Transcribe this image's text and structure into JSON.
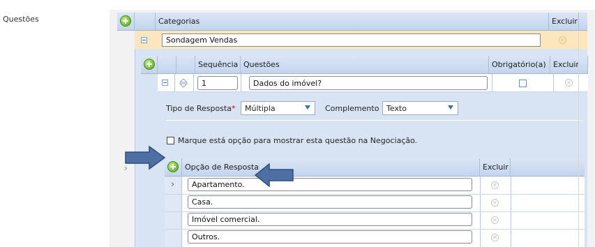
{
  "page": {
    "label": "Questões"
  },
  "categories_grid": {
    "header": {
      "col_categorias": "Categorias",
      "col_excluir": "Excluir"
    },
    "row": {
      "value": "Sondagem Vendas"
    }
  },
  "questions_grid": {
    "header": {
      "col_sequencia": "Sequência",
      "col_questoes": "Questões",
      "col_obrigatorio": "Obrigatório(a)",
      "col_excluir": "Excluir"
    },
    "row": {
      "sequencia": "1",
      "questao": "Dados do imóvel?",
      "obrigatorio_checked": false
    }
  },
  "question_detail": {
    "tipo_label": "Tipo de Resposta",
    "required_mark": "*",
    "tipo_value": "Múltipla",
    "complemento_label": "Complemento",
    "complemento_value": "Texto",
    "checkbox_label": "Marque está opção para mostrar esta questão na Negociação."
  },
  "answers_grid": {
    "header": {
      "col_opcao": "Opção de Resposta",
      "col_excluir": "Excluir"
    },
    "rows": [
      {
        "value": "Apartamento."
      },
      {
        "value": "Casa."
      },
      {
        "value": "Imóvel comercial."
      },
      {
        "value": "Outros."
      }
    ]
  },
  "icons": {
    "add": "plus-circle-icon",
    "delete": "x-circle-icon",
    "collapse": "minus-box-icon",
    "expand": "chevron-right-icon",
    "sort": "sort-arrows-icon",
    "annotation": "blue-arrow-icon"
  },
  "colors": {
    "header_blue": "#c3d4ec",
    "detail_blue": "#d8e4f3",
    "category_row": "#fbe6bd",
    "annotation_arrow": "#4d6fa3",
    "add_green": "#4ca61a"
  }
}
